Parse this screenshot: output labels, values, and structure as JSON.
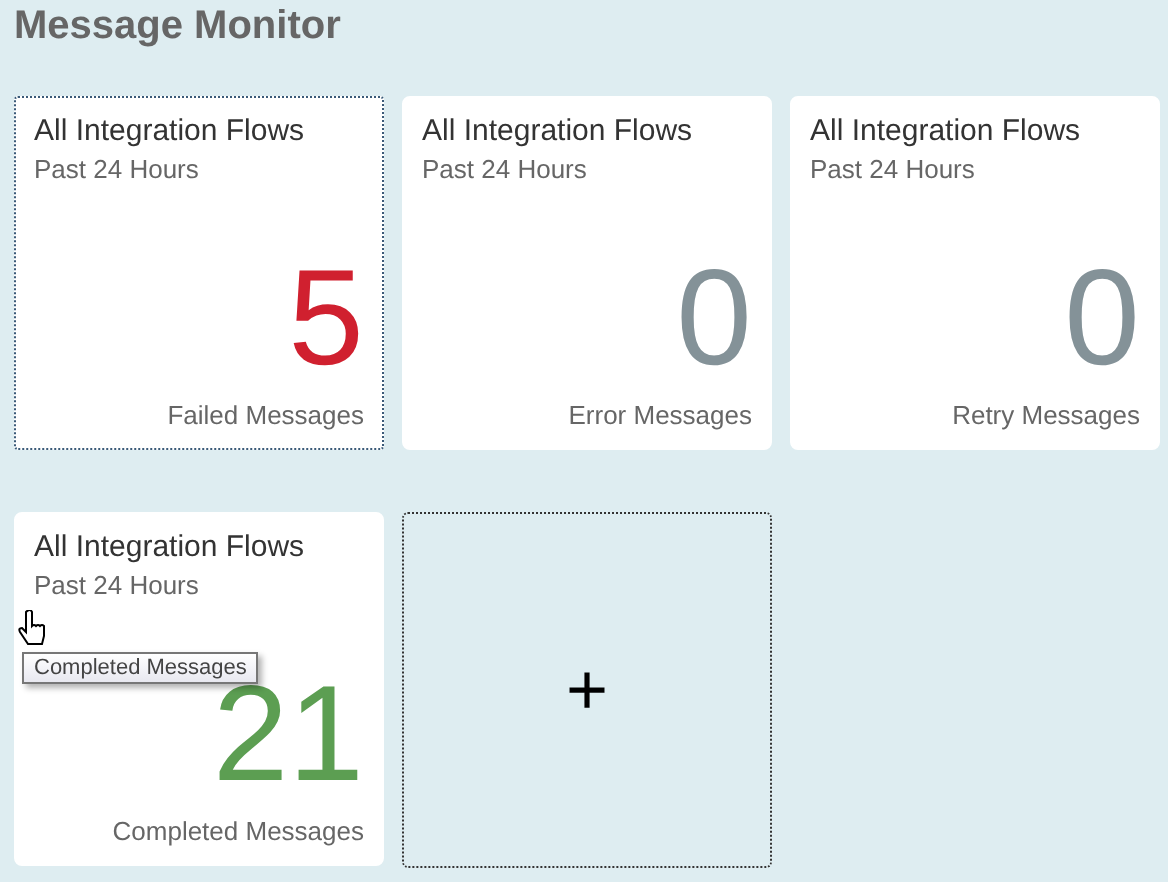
{
  "page": {
    "title": "Message Monitor"
  },
  "tiles": [
    {
      "title": "All Integration Flows",
      "subtitle": "Past 24 Hours",
      "count": "5",
      "label": "Failed Messages",
      "color": "#d0202f",
      "focused": true
    },
    {
      "title": "All Integration Flows",
      "subtitle": "Past 24 Hours",
      "count": "0",
      "label": "Error Messages",
      "color": "#849298",
      "focused": false
    },
    {
      "title": "All Integration Flows",
      "subtitle": "Past 24 Hours",
      "count": "0",
      "label": "Retry Messages",
      "color": "#849298",
      "focused": false
    },
    {
      "title": "All Integration Flows",
      "subtitle": "Past 24 Hours",
      "count": "21",
      "label": "Completed Messages",
      "color": "#5c9e52",
      "focused": false
    }
  ],
  "add_tile": {
    "symbol": "+"
  },
  "tooltip": {
    "text": "Completed Messages"
  }
}
